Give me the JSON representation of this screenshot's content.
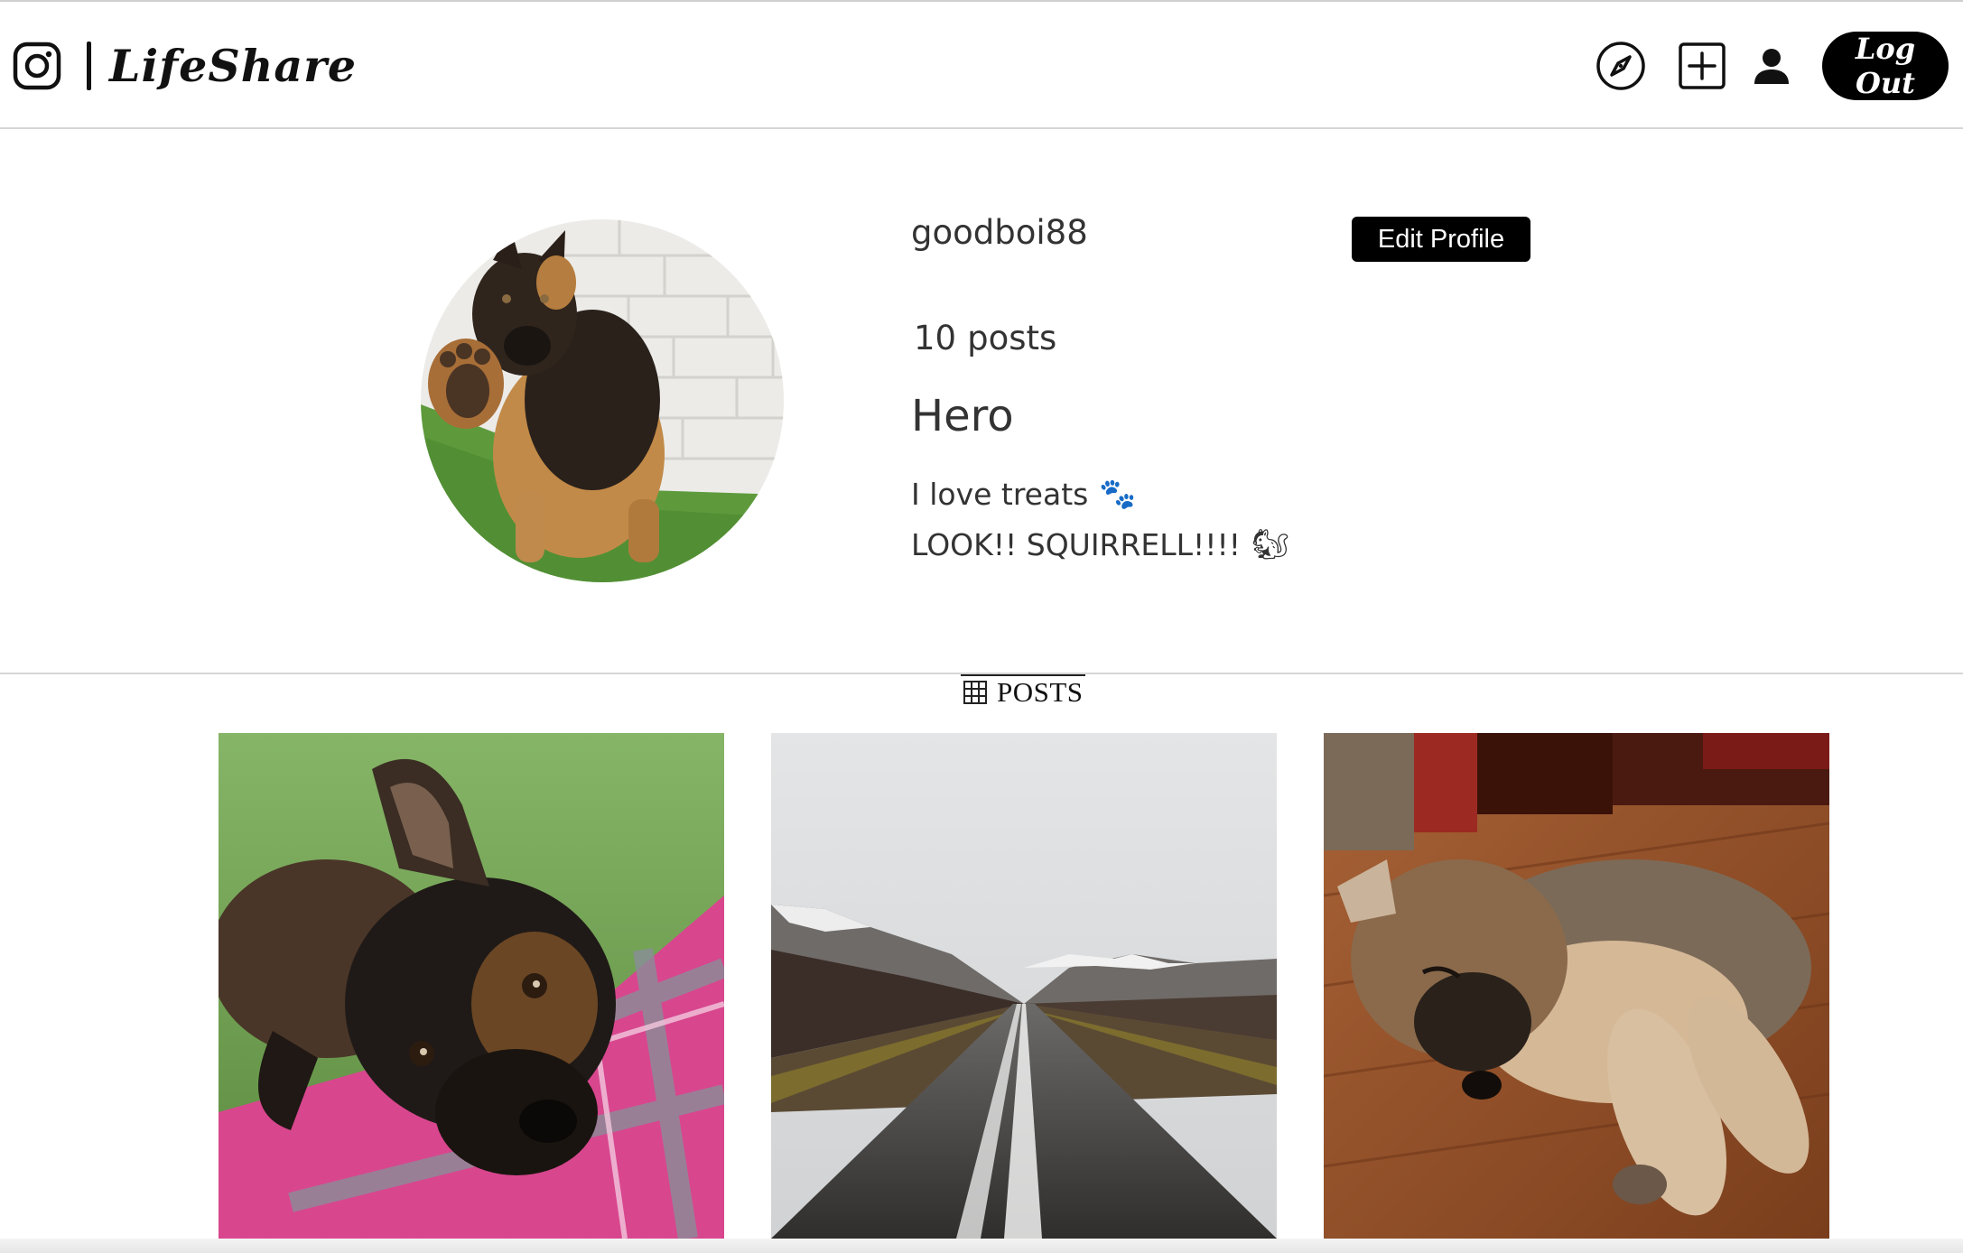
{
  "app": {
    "name": "LifeShare",
    "brand_icon": "instagram-camera-icon"
  },
  "nav": {
    "explore_icon": "compass-icon",
    "add_icon": "plus-square-icon",
    "profile_icon": "user-icon",
    "logout_label": "Log Out"
  },
  "profile": {
    "username": "goodboi88",
    "edit_label": "Edit Profile",
    "post_count": "10",
    "post_count_label": "posts",
    "display_name": "Hero",
    "bio": [
      {
        "text": "I love treats",
        "emoji": "🐾"
      },
      {
        "text": "LOOK!! SQUIRRELL!!!!",
        "emoji": "🐿"
      }
    ],
    "avatar_icon": "profile-photo-puppy"
  },
  "tabs": {
    "posts_label": "POSTS",
    "posts_icon": "grid-icon"
  },
  "posts": [
    {
      "subject": "puppy-on-plaid-blanket"
    },
    {
      "subject": "empty-mountain-road"
    },
    {
      "subject": "sleeping-puppy-on-floor"
    }
  ],
  "colors": {
    "button_bg": "#000000",
    "button_text": "#ffffff",
    "text": "#333333",
    "divider": "#d6d6d6"
  }
}
